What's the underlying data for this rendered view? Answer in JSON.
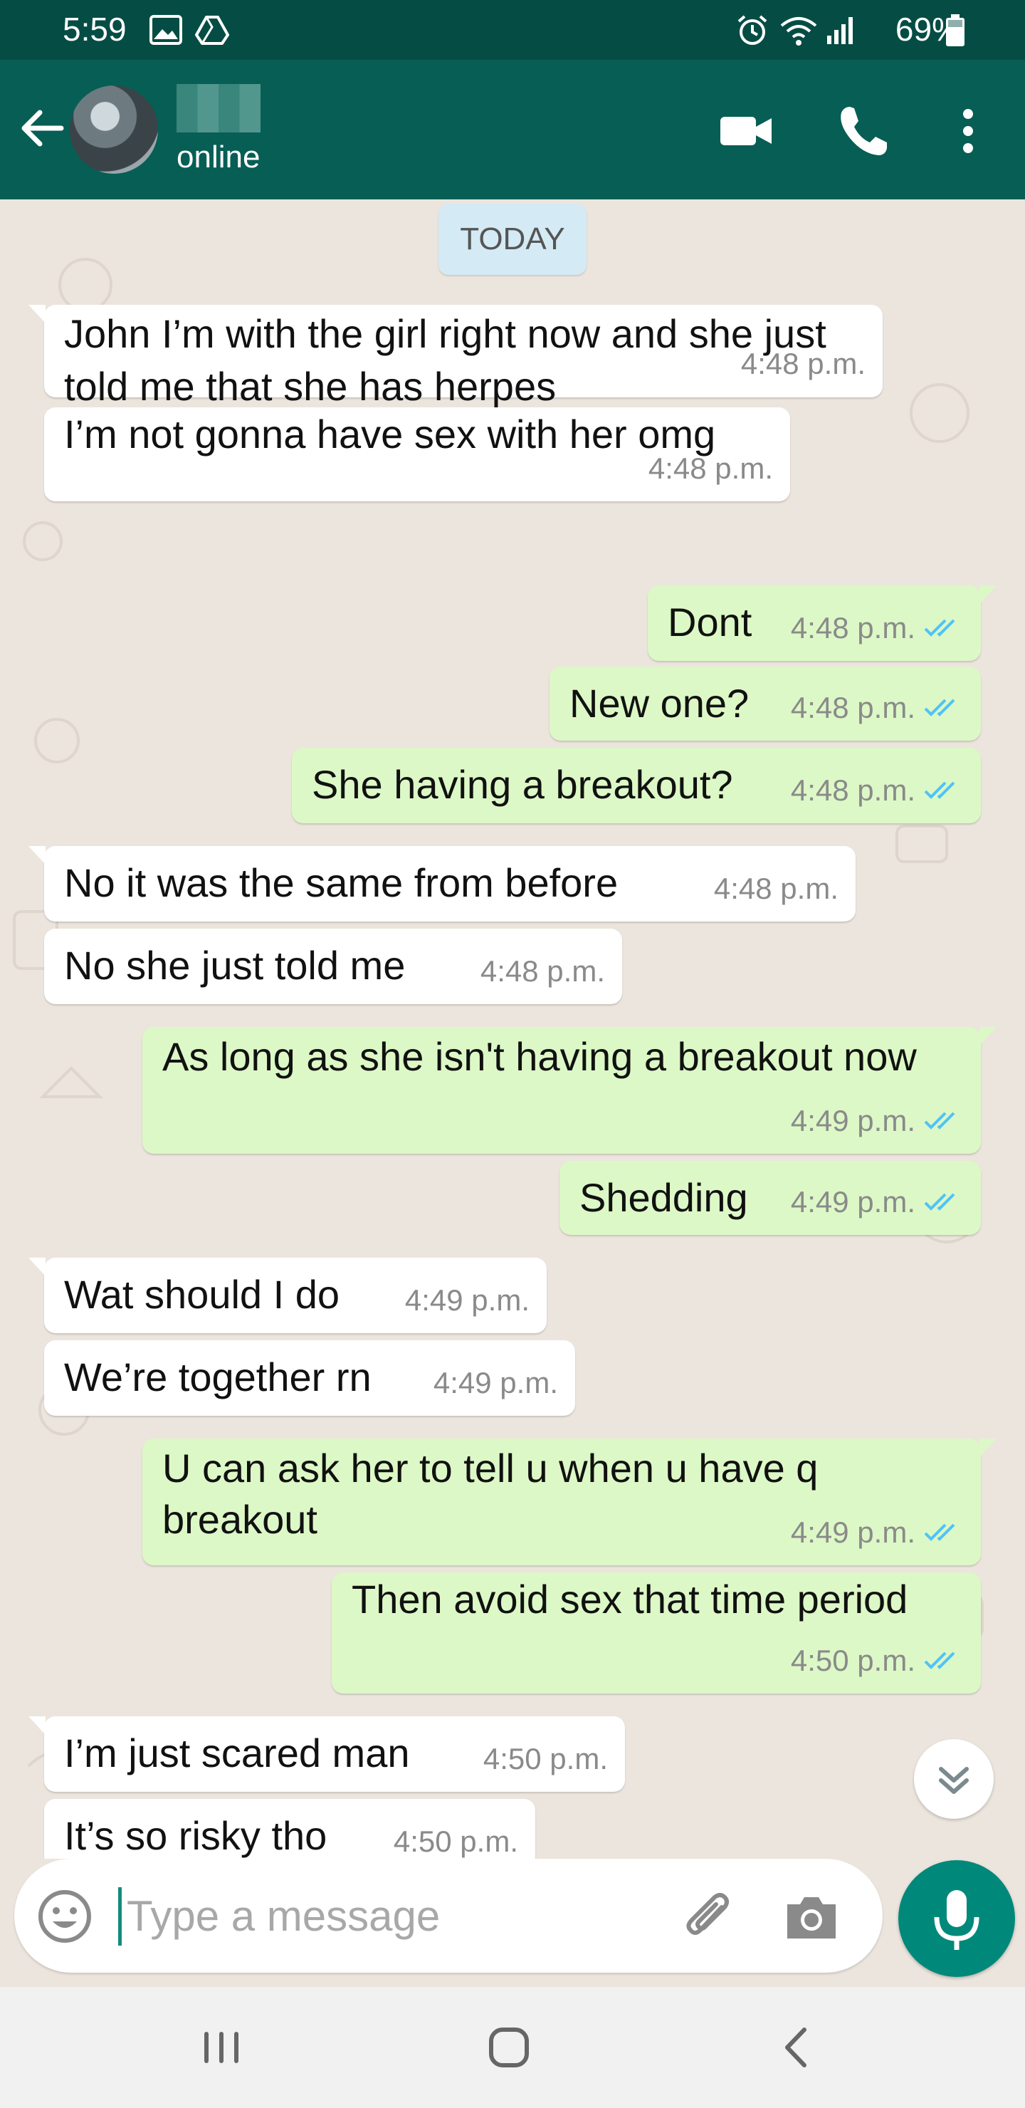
{
  "status_bar": {
    "time": "5:59",
    "battery": "69%",
    "icons": [
      "gallery-icon",
      "drive-icon",
      "alarm-icon",
      "wifi-icon",
      "signal-icon",
      "battery-icon"
    ]
  },
  "header": {
    "contact_status": "online",
    "actions": [
      "video-call-icon",
      "voice-call-icon",
      "more-options-icon"
    ]
  },
  "chat": {
    "date_chip": "TODAY",
    "messages": [
      {
        "dir": "in",
        "text": "John I’m with the girl right now and she just told me that she has herpes",
        "time": "4:48 p.m."
      },
      {
        "dir": "in",
        "text": "I’m not gonna have sex with her omg",
        "time": "4:48 p.m."
      },
      {
        "dir": "out",
        "text": "Dont",
        "time": "4:48 p.m."
      },
      {
        "dir": "out",
        "text": "New one?",
        "time": "4:48 p.m."
      },
      {
        "dir": "out",
        "text": "She having a breakout?",
        "time": "4:48 p.m."
      },
      {
        "dir": "in",
        "text": "No it was the same from before",
        "time": "4:48 p.m."
      },
      {
        "dir": "in",
        "text": "No she just told me",
        "time": "4:48 p.m."
      },
      {
        "dir": "out",
        "text": "As long as she isn't having a breakout now",
        "time": "4:49 p.m."
      },
      {
        "dir": "out",
        "text": "Shedding",
        "time": "4:49 p.m."
      },
      {
        "dir": "in",
        "text": "Wat should I do",
        "time": "4:49 p.m."
      },
      {
        "dir": "in",
        "text": "We’re together rn",
        "time": "4:49 p.m."
      },
      {
        "dir": "out",
        "text": "U can ask her to tell u when u have q breakout",
        "time": "4:49 p.m."
      },
      {
        "dir": "out",
        "text": "Then avoid sex that time period",
        "time": "4:50 p.m."
      },
      {
        "dir": "in",
        "text": "I’m just scared man",
        "time": "4:50 p.m."
      },
      {
        "dir": "in",
        "text": "It’s so risky tho",
        "time": "4:50 p.m."
      }
    ]
  },
  "input": {
    "placeholder": "Type a message"
  },
  "colors": {
    "header": "#075E54",
    "status_bar": "#054D44",
    "outgoing_bubble": "#DCF8C6",
    "incoming_bubble": "#FFFFFF",
    "read_ticks": "#4FC3F7",
    "mic_button": "#00897B"
  }
}
